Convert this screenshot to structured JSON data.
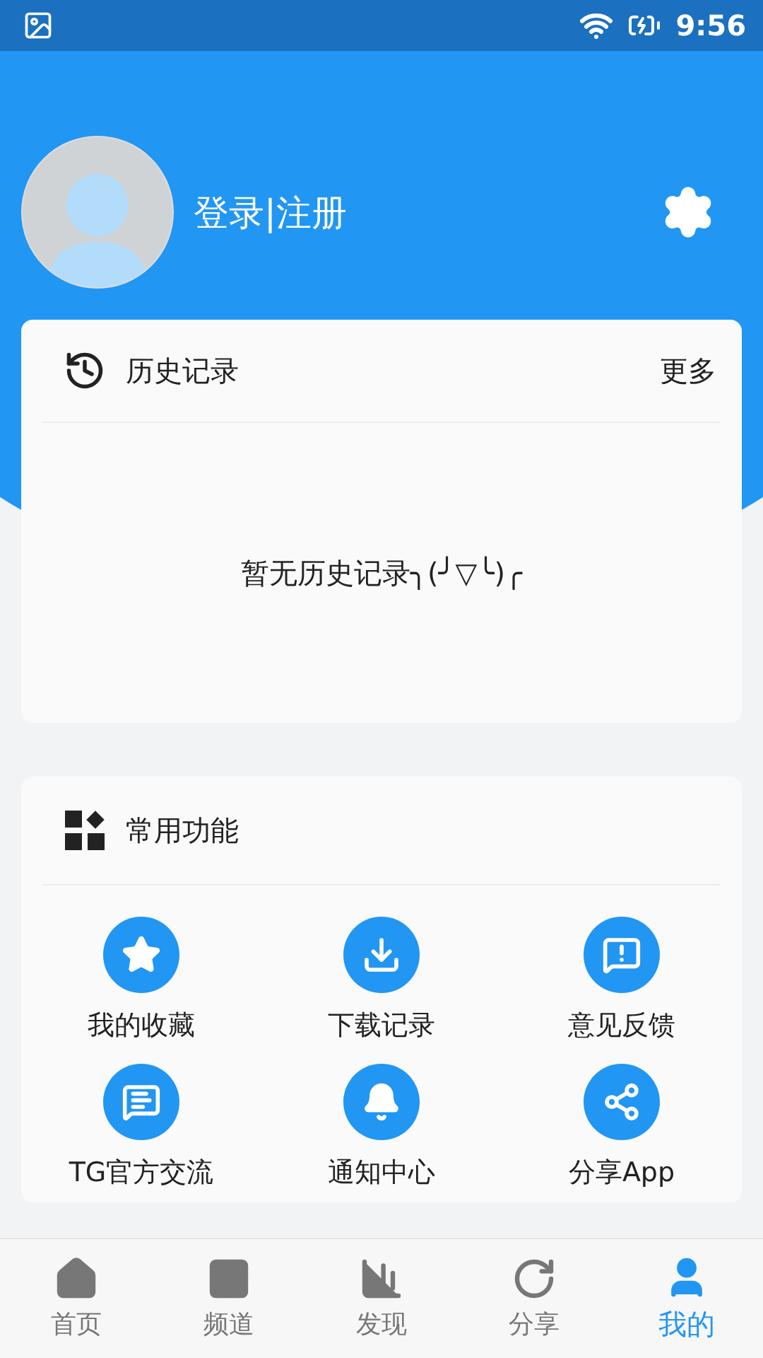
{
  "status_bar": {
    "time": "9:56"
  },
  "profile": {
    "login_label": "登录|注册"
  },
  "history": {
    "title": "历史记录",
    "more": "更多",
    "empty_message": "暂无历史记录╮(╯▽╰)╭"
  },
  "functions": {
    "title": "常用功能",
    "items": [
      {
        "kind": "favorites",
        "label": "我的收藏"
      },
      {
        "kind": "downloads",
        "label": "下载记录"
      },
      {
        "kind": "feedback",
        "label": "意见反馈"
      },
      {
        "kind": "chat",
        "label": "TG官方交流"
      },
      {
        "kind": "notifications",
        "label": "通知中心"
      },
      {
        "kind": "share",
        "label": "分享App"
      }
    ]
  },
  "bottom_nav": [
    {
      "kind": "home",
      "label": "首页",
      "selected": false
    },
    {
      "kind": "channels",
      "label": "频道",
      "selected": false
    },
    {
      "kind": "discover",
      "label": "发现",
      "selected": false
    },
    {
      "kind": "share",
      "label": "分享",
      "selected": false
    },
    {
      "kind": "me",
      "label": "我的",
      "selected": true
    }
  ]
}
